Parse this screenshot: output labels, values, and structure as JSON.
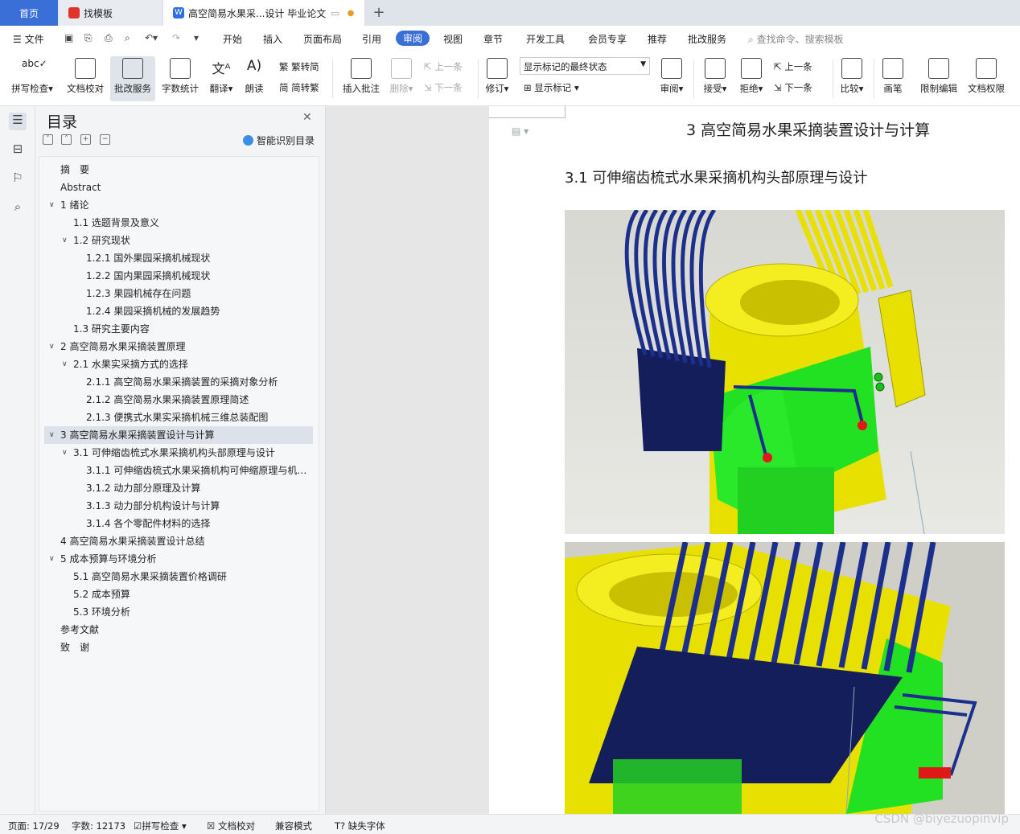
{
  "tabs": {
    "home": "首页",
    "template": "找模板",
    "document": "高空简易水果采...设计 毕业论文"
  },
  "menu": {
    "file": "文件",
    "items": [
      "开始",
      "插入",
      "页面布局",
      "引用",
      "审阅",
      "视图",
      "章节",
      "开发工具",
      "会员专享",
      "推荐",
      "批改服务"
    ],
    "active": "审阅",
    "search_placeholder": "查找命令、搜索模板"
  },
  "ribbon": {
    "spell_check": "拼写检查",
    "doc_proof": "文档校对",
    "review_service": "批改服务",
    "word_count": "字数统计",
    "translate": "翻译",
    "read_aloud": "朗读",
    "to_traditional": "繁转简",
    "to_simplified": "简转繁",
    "insert_comment": "插入批注",
    "delete": "删除",
    "prev": "上一条",
    "next": "下一条",
    "revise": "修订",
    "markup_state": "显示标记的最终状态",
    "show_markup": "显示标记",
    "review": "审阅",
    "accept": "接受",
    "reject": "拒绝",
    "prev2": "上一条",
    "next2": "下一条",
    "compare": "比较",
    "pen": "画笔",
    "restrict_edit": "限制编辑",
    "doc_permission": "文档权限"
  },
  "toc": {
    "title": "目录",
    "smart_recognize": "智能识别目录",
    "items": [
      {
        "text": "摘　要",
        "level": 0,
        "expand": ""
      },
      {
        "text": "Abstract",
        "level": 0,
        "expand": ""
      },
      {
        "text": "1  绪论",
        "level": 0,
        "expand": "v"
      },
      {
        "text": "1.1  选题背景及意义",
        "level": 1,
        "expand": ""
      },
      {
        "text": "1.2 研究现状",
        "level": 1,
        "expand": "v"
      },
      {
        "text": "1.2.1 国外果园采摘机械现状",
        "level": 2,
        "expand": ""
      },
      {
        "text": "1.2.2 国内果园采摘机械现状",
        "level": 2,
        "expand": ""
      },
      {
        "text": "1.2.3 果园机械存在问题",
        "level": 2,
        "expand": ""
      },
      {
        "text": "1.2.4 果园采摘机械的发展趋势",
        "level": 2,
        "expand": ""
      },
      {
        "text": "1.3 研究主要内容",
        "level": 1,
        "expand": ""
      },
      {
        "text": "2  高空简易水果采摘装置原理",
        "level": 0,
        "expand": "v"
      },
      {
        "text": "2.1    水果实采摘方式的选择",
        "level": 1,
        "expand": "v"
      },
      {
        "text": "2.1.1 高空简易水果采摘装置的采摘对象分析",
        "level": 2,
        "expand": ""
      },
      {
        "text": "2.1.2 高空简易水果采摘装置原理简述",
        "level": 2,
        "expand": ""
      },
      {
        "text": "2.1.3 便携式水果实采摘机械三维总装配图",
        "level": 2,
        "expand": ""
      },
      {
        "text": "3  高空简易水果采摘装置设计与计算",
        "level": 0,
        "expand": "v",
        "selected": true
      },
      {
        "text": "3.1 可伸缩齿梳式水果采摘机构头部原理与设计",
        "level": 1,
        "expand": "v"
      },
      {
        "text": "3.1.1 可伸缩齿梳式水果采摘机构可伸缩原理与机…",
        "level": 2,
        "expand": ""
      },
      {
        "text": "3.1.2 动力部分原理及计算",
        "level": 2,
        "expand": ""
      },
      {
        "text": "3.1.3 动力部分机构设计与计算",
        "level": 2,
        "expand": ""
      },
      {
        "text": "3.1.4 各个零配件材料的选择",
        "level": 2,
        "expand": ""
      },
      {
        "text": "4  高空简易水果采摘装置设计总结",
        "level": 0,
        "expand": ""
      },
      {
        "text": "5  成本预算与环境分析",
        "level": 0,
        "expand": "v"
      },
      {
        "text": "5.1  高空简易水果采摘装置价格调研",
        "level": 1,
        "expand": ""
      },
      {
        "text": "5.2  成本预算",
        "level": 1,
        "expand": ""
      },
      {
        "text": "5.3  环境分析",
        "level": 1,
        "expand": ""
      },
      {
        "text": "参考文献",
        "level": 0,
        "expand": ""
      },
      {
        "text": "致　谢",
        "level": 0,
        "expand": ""
      }
    ]
  },
  "document": {
    "chapter_title": "3  高空简易水果采摘装置设计与计算",
    "section_title": "3.1 可伸缩齿梳式水果采摘机构头部原理与设计"
  },
  "status": {
    "page": "页面: 17/29",
    "words": "字数: 12173",
    "spell": "拼写检查",
    "proof": "文档校对",
    "compat": "兼容模式",
    "missing_font": "缺失字体"
  },
  "watermark": "CSDN @biyezuopinvip",
  "colors": {
    "accent": "#3a6fd8",
    "tines_blue": "#1c2f8c",
    "tines_yellow": "#e8e000",
    "body_green": "#22e022",
    "plate_navy": "#141e5a"
  }
}
